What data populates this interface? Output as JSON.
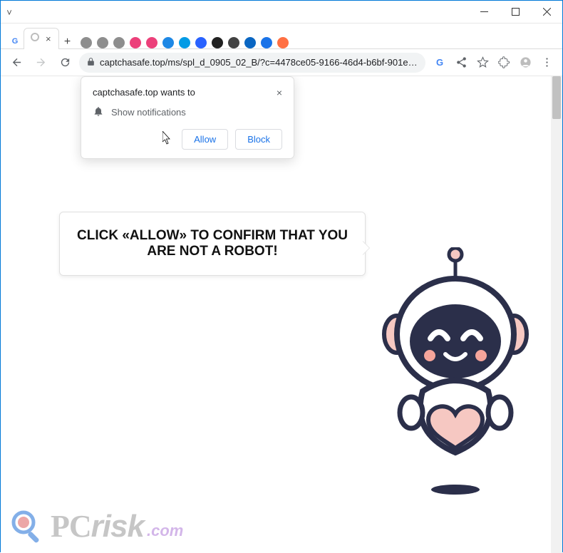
{
  "title_controls": {
    "chevron": "˅"
  },
  "tabs": {
    "active_close": "×",
    "new_tab": "+"
  },
  "toolbar": {
    "url": "captchasafe.top/ms/spl_d_0905_02_B/?c=4478ce05-9166-46d4-b6bf-901eceeea..."
  },
  "permission": {
    "origin_line": "captchasafe.top wants to",
    "request_label": "Show notifications",
    "allow_label": "Allow",
    "block_label": "Block",
    "close": "×"
  },
  "page": {
    "bubble_text": "CLICK «ALLOW» TO CONFIRM THAT YOU ARE NOT A ROBOT!"
  },
  "watermark": {
    "brand": "PCrisk",
    "domain": ".com"
  },
  "icons": {
    "favicons": [
      {
        "name": "google-g-icon",
        "glyph": "G",
        "color": "#4285f4"
      }
    ],
    "tail": [
      {
        "name": "globe-icon",
        "bg": "#8e8e8e"
      },
      {
        "name": "globe-icon",
        "bg": "#8e8e8e"
      },
      {
        "name": "globe-icon",
        "bg": "#8e8e8e"
      },
      {
        "name": "o-pink-icon",
        "bg": "#ec407a"
      },
      {
        "name": "o-pink-icon",
        "bg": "#ec407a"
      },
      {
        "name": "dot-blue-icon",
        "bg": "#1e88e5"
      },
      {
        "name": "tsk-icon",
        "bg": "#039be5"
      },
      {
        "name": "v-shield-icon",
        "bg": "#2962ff"
      },
      {
        "name": "d-circle-icon",
        "bg": "#212121"
      },
      {
        "name": "square-icon",
        "bg": "#424242"
      },
      {
        "name": "linkedin-icon",
        "bg": "#0a66c2"
      },
      {
        "name": "grid-icon",
        "bg": "#1a73e8"
      },
      {
        "name": "orange-sq-icon",
        "bg": "#ff7043"
      }
    ]
  }
}
